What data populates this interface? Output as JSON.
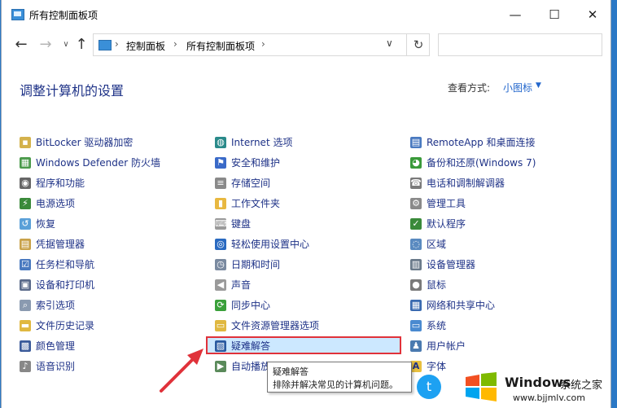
{
  "window": {
    "title": "所有控制面板项"
  },
  "titlebar": {
    "min": "—",
    "max": "☐",
    "close": "✕"
  },
  "nav": {
    "back": "←",
    "forward": "→",
    "recent": "∨",
    "up": "↑"
  },
  "address": {
    "crumbs": [
      "控制面板",
      "所有控制面板项"
    ],
    "sep": "›",
    "dropdown": "∨",
    "refresh": "↻"
  },
  "search": {
    "value": "",
    "placeholder": ""
  },
  "header": {
    "title": "调整计算机的设置",
    "view_label": "查看方式:",
    "view_value": "小图标",
    "view_arrow": "▼"
  },
  "items": {
    "col1": [
      {
        "label": "BitLocker 驱动器加密",
        "icon": "bitlocker-icon"
      },
      {
        "label": "Windows Defender 防火墙",
        "icon": "firewall-icon"
      },
      {
        "label": "程序和功能",
        "icon": "programs-icon"
      },
      {
        "label": "电源选项",
        "icon": "power-icon"
      },
      {
        "label": "恢复",
        "icon": "recovery-icon"
      },
      {
        "label": "凭据管理器",
        "icon": "credential-icon"
      },
      {
        "label": "任务栏和导航",
        "icon": "taskbar-icon"
      },
      {
        "label": "设备和打印机",
        "icon": "printer-icon"
      },
      {
        "label": "索引选项",
        "icon": "index-icon"
      },
      {
        "label": "文件历史记录",
        "icon": "file-history-icon"
      },
      {
        "label": "颜色管理",
        "icon": "color-icon"
      },
      {
        "label": "语音识别",
        "icon": "microphone-icon"
      }
    ],
    "col2": [
      {
        "label": "Internet 选项",
        "icon": "internet-icon"
      },
      {
        "label": "安全和维护",
        "icon": "flag-icon"
      },
      {
        "label": "存储空间",
        "icon": "storage-icon"
      },
      {
        "label": "工作文件夹",
        "icon": "folder-icon"
      },
      {
        "label": "键盘",
        "icon": "keyboard-icon"
      },
      {
        "label": "轻松使用设置中心",
        "icon": "ease-of-access-icon"
      },
      {
        "label": "日期和时间",
        "icon": "clock-icon"
      },
      {
        "label": "声音",
        "icon": "speaker-icon"
      },
      {
        "label": "同步中心",
        "icon": "sync-icon"
      },
      {
        "label": "文件资源管理器选项",
        "icon": "folder-options-icon"
      },
      {
        "label": "疑难解答",
        "icon": "troubleshoot-icon"
      },
      {
        "label": "自动播放",
        "icon": "autoplay-icon"
      }
    ],
    "col3": [
      {
        "label": "RemoteApp 和桌面连接",
        "icon": "remoteapp-icon"
      },
      {
        "label": "备份和还原(Windows 7)",
        "icon": "backup-icon"
      },
      {
        "label": "电话和调制解调器",
        "icon": "phone-icon"
      },
      {
        "label": "管理工具",
        "icon": "tools-icon"
      },
      {
        "label": "默认程序",
        "icon": "default-programs-icon"
      },
      {
        "label": "区域",
        "icon": "region-icon"
      },
      {
        "label": "设备管理器",
        "icon": "device-manager-icon"
      },
      {
        "label": "鼠标",
        "icon": "mouse-icon"
      },
      {
        "label": "网络和共享中心",
        "icon": "network-icon"
      },
      {
        "label": "系统",
        "icon": "system-icon"
      },
      {
        "label": "用户帐户",
        "icon": "user-icon"
      },
      {
        "label": "字体",
        "icon": "font-icon"
      }
    ]
  },
  "tooltip": {
    "title": "疑难解答",
    "desc": "排除并解决常见的计算机问题。"
  },
  "watermark": {
    "brand": "Windows",
    "cn": "系统之家",
    "url": "www.bjjmlv.com",
    "twitter": "t"
  },
  "colors": {
    "link": "#1e3287",
    "accent": "#2266cc",
    "highlight": "#cce8ff",
    "annotation": "#e0323a"
  }
}
